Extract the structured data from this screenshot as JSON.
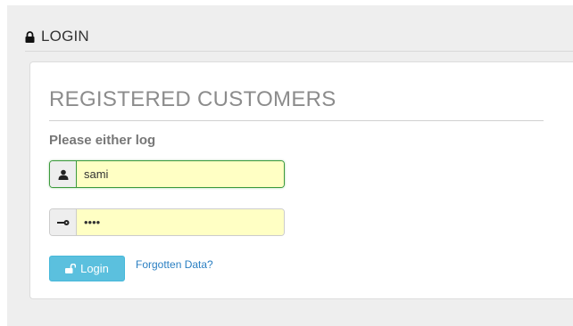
{
  "section": {
    "heading": "LOGIN",
    "heading_icon": "lock-icon"
  },
  "panel": {
    "title": "REGISTERED CUSTOMERS",
    "prompt": "Please either log"
  },
  "form": {
    "username": {
      "value": "sami",
      "icon": "user-icon"
    },
    "password": {
      "value": "sami",
      "icon": "key-icon"
    },
    "login_button": {
      "label": "Login",
      "icon": "unlock-icon"
    },
    "forgot_link": "Forgotten Data?"
  },
  "colors": {
    "button": "#5bc0de",
    "link": "#2a7fc2",
    "autofill": "#ffffc4",
    "focus_border": "#3c9a3c"
  }
}
